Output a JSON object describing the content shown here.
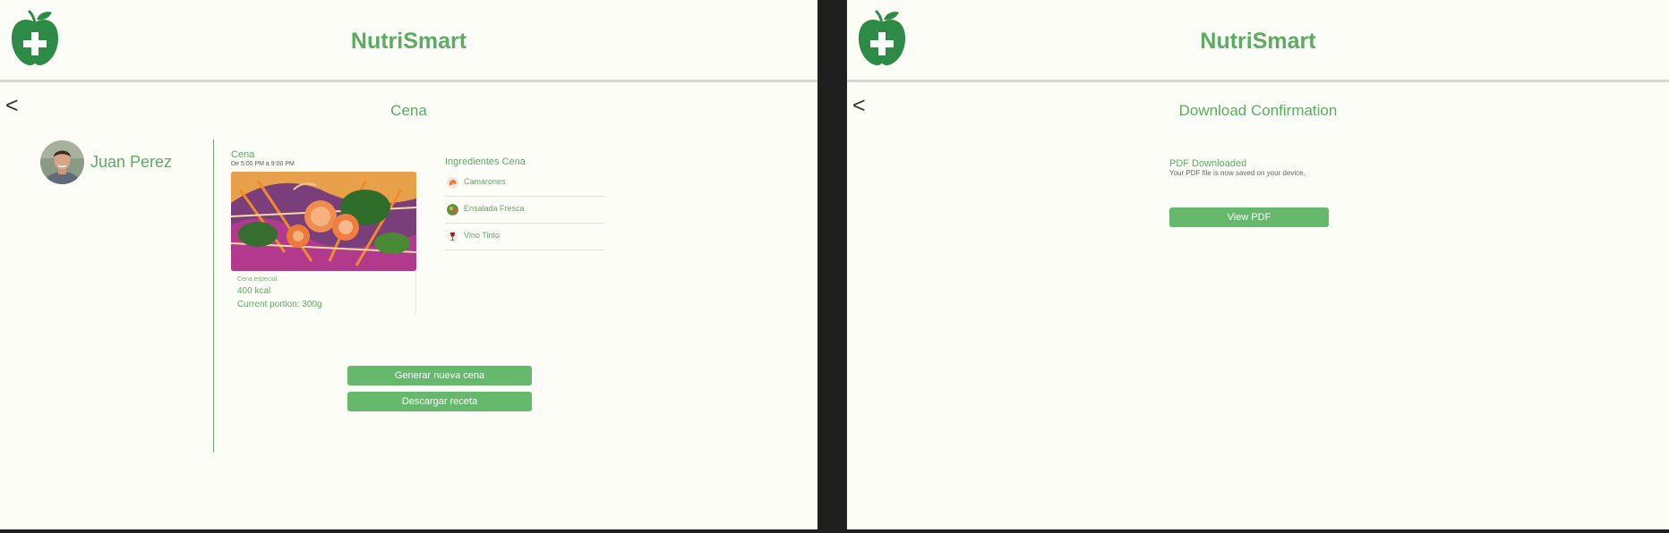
{
  "colors": {
    "brand_green": "#5bab62",
    "button_green": "#66b86c",
    "logo_green": "#2e8b45",
    "background": "#fdfdf8"
  },
  "left_screen": {
    "app_name": "NutriSmart",
    "back_icon": "<",
    "page_title": "Cena",
    "user": {
      "name": "Juan Perez"
    },
    "meal": {
      "title": "Cena",
      "time": "De 5:00 PM a 9:00 PM",
      "tag": "Cena especial",
      "kcal": "400 kcal",
      "portion": "Current portion: 300g"
    },
    "ingredients": {
      "title": "Ingredientes Cena",
      "items": [
        {
          "label": "Camarones",
          "icon": "shrimp-icon"
        },
        {
          "label": "Ensalada Fresca",
          "icon": "salad-icon"
        },
        {
          "label": "Vino Tinto",
          "icon": "wine-icon"
        }
      ]
    },
    "buttons": {
      "generate": "Generar nueva cena",
      "download": "Descargar receta"
    }
  },
  "right_screen": {
    "app_name": "NutriSmart",
    "back_icon": "<",
    "page_title": "Download Confirmation",
    "download": {
      "title": "PDF Downloaded",
      "subtitle": "Your PDF file is now saved on your device."
    },
    "buttons": {
      "view_pdf": "View PDF"
    }
  }
}
